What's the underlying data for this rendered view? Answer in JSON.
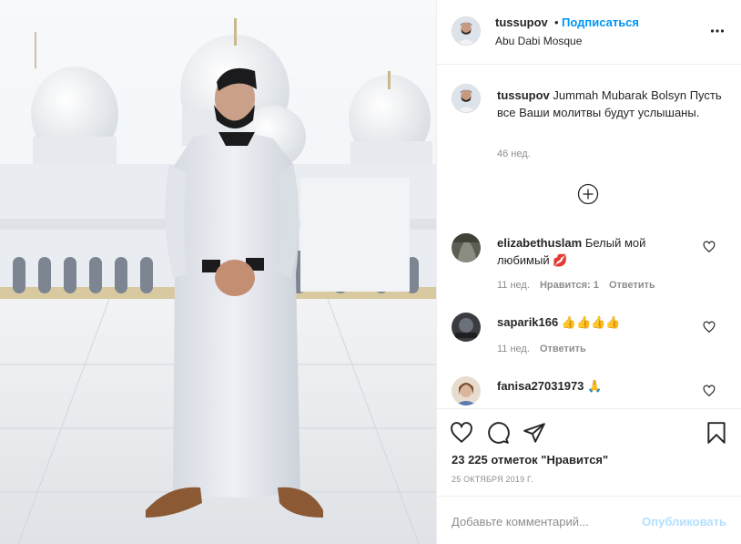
{
  "colors": {
    "accent": "#0095f6",
    "accent_disabled": "#b2dffc",
    "text": "#262626",
    "muted": "#8e8e8e",
    "divider": "#efefef"
  },
  "post": {
    "image_alt": "Man in white thobe in front of Abu Dhabi mosque",
    "header": {
      "username": "tussupov",
      "separator": "•",
      "follow_label": "Подписаться",
      "location": "Abu Dabi Mosque",
      "more_icon": "more-horizontal-icon"
    },
    "caption": {
      "username": "tussupov",
      "text": "Jummah Mubarak Bolsyn Пусть все Ваши молитвы будут услышаны.",
      "time": "46 нед."
    },
    "load_more_icon": "plus-circle-icon",
    "comments": [
      {
        "username": "elizabethuslam",
        "text": "Белый мой любимый",
        "emoji": "💋",
        "time": "11 нед.",
        "likes": "Нравится: 1",
        "reply": "Ответить"
      },
      {
        "username": "saparik166",
        "text": "",
        "emoji": "👍👍👍👍",
        "time": "11 нед.",
        "likes": "",
        "reply": "Ответить"
      },
      {
        "username": "fanisa27031973",
        "text": "",
        "emoji": "🙏",
        "time": "",
        "likes": "",
        "reply": ""
      }
    ],
    "actions": {
      "like_icon": "heart-icon",
      "comment_icon": "comment-icon",
      "share_icon": "paper-plane-icon",
      "save_icon": "bookmark-icon"
    },
    "likes_text": "23 225 отметок \"Нравится\"",
    "date": "25 ОКТЯБРЯ 2019 Г.",
    "add_comment": {
      "placeholder": "Добавьте комментарий...",
      "post_label": "Опубликовать"
    }
  }
}
